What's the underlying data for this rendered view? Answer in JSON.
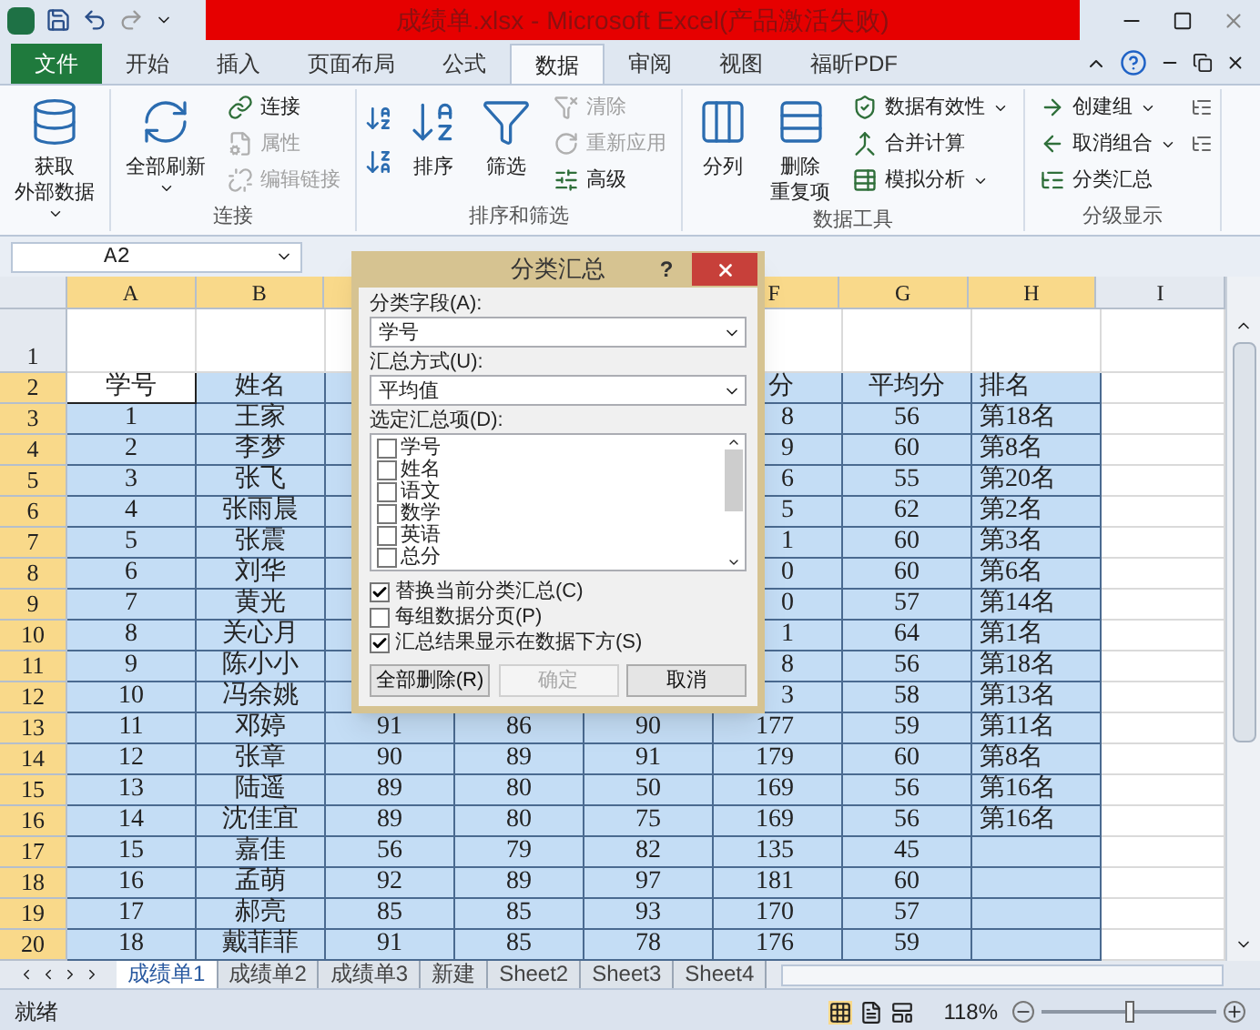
{
  "window": {
    "title": "成绩单.xlsx - Microsoft Excel(产品激活失败)"
  },
  "ribbon_tabs": [
    {
      "label": "文件",
      "kind": "file",
      "selected": false
    },
    {
      "label": "开始",
      "kind": "tab",
      "selected": false
    },
    {
      "label": "插入",
      "kind": "tab",
      "selected": false
    },
    {
      "label": "页面布局",
      "kind": "tab",
      "selected": false
    },
    {
      "label": "公式",
      "kind": "tab",
      "selected": false
    },
    {
      "label": "数据",
      "kind": "tab",
      "selected": true
    },
    {
      "label": "审阅",
      "kind": "tab",
      "selected": false
    },
    {
      "label": "视图",
      "kind": "tab",
      "selected": false
    },
    {
      "label": "福昕PDF",
      "kind": "tab",
      "selected": false
    }
  ],
  "ribbon_groups": [
    {
      "buttons": [
        {
          "lines": [
            "获取",
            "外部数据"
          ],
          "dropdown": true,
          "disabled": false
        }
      ]
    },
    {
      "label": "连接",
      "buttons": [
        {
          "lines": [
            "全部刷新"
          ],
          "dropdown": true,
          "disabled": false
        },
        {
          "lines": [
            "连接"
          ],
          "dropdown": false,
          "disabled": false
        },
        {
          "lines": [
            "属性"
          ],
          "dropdown": false,
          "disabled": true
        },
        {
          "lines": [
            "编辑链接"
          ],
          "dropdown": false,
          "disabled": true
        }
      ]
    },
    {
      "label": "排序和筛选",
      "buttons": [
        {
          "lines": [
            "排序"
          ],
          "dropdown": false,
          "disabled": false
        },
        {
          "lines": [
            "筛选"
          ],
          "dropdown": false,
          "disabled": false
        },
        {
          "lines": [
            "清除"
          ],
          "dropdown": false,
          "disabled": true
        },
        {
          "lines": [
            "重新应用"
          ],
          "dropdown": false,
          "disabled": true
        },
        {
          "lines": [
            "高级"
          ],
          "dropdown": false,
          "disabled": false
        }
      ]
    },
    {
      "label": "数据工具",
      "buttons": [
        {
          "lines": [
            "分列"
          ],
          "dropdown": false,
          "disabled": false
        },
        {
          "lines": [
            "删除",
            "重复项"
          ],
          "dropdown": false,
          "disabled": false
        },
        {
          "lines": [
            "数据有效性"
          ],
          "dropdown": true,
          "disabled": false
        },
        {
          "lines": [
            "合并计算"
          ],
          "dropdown": false,
          "disabled": false
        },
        {
          "lines": [
            "模拟分析"
          ],
          "dropdown": true,
          "disabled": false
        }
      ]
    },
    {
      "label": "分级显示",
      "buttons": [
        {
          "lines": [
            "创建组"
          ],
          "dropdown": true,
          "disabled": false
        },
        {
          "lines": [
            "取消组合"
          ],
          "dropdown": true,
          "disabled": false
        },
        {
          "lines": [
            "分类汇总"
          ],
          "dropdown": false,
          "disabled": false
        }
      ]
    }
  ],
  "name_box": "A2",
  "columns": [
    {
      "letter": "A",
      "highlighted": true
    },
    {
      "letter": "B",
      "highlighted": true
    },
    {
      "highlighted": true
    },
    {
      "letter": "F",
      "highlighted": true
    },
    {
      "letter": "G",
      "highlighted": true
    },
    {
      "letter": "H",
      "highlighted": true
    },
    {
      "letter": "I",
      "highlighted": false
    }
  ],
  "rows": [
    {
      "number": "1",
      "highlighted": false,
      "selected": false,
      "active": false,
      "cells": [
        null,
        null,
        null,
        null,
        null,
        null,
        null,
        null,
        null
      ]
    },
    {
      "number": "2",
      "highlighted": true,
      "selected": true,
      "active": true,
      "cells": [
        "学号",
        "姓名",
        null,
        null,
        null,
        "分",
        "平均分",
        "排名",
        null
      ]
    },
    {
      "number": "3",
      "highlighted": true,
      "selected": true,
      "active": false,
      "cells": [
        "1",
        "王家",
        null,
        null,
        null,
        "8",
        "56",
        "第18名",
        null
      ]
    },
    {
      "number": "4",
      "highlighted": true,
      "selected": true,
      "active": false,
      "cells": [
        "2",
        "李梦",
        null,
        null,
        null,
        "9",
        "60",
        "第8名",
        null
      ]
    },
    {
      "number": "5",
      "highlighted": true,
      "selected": true,
      "active": false,
      "cells": [
        "3",
        "张飞",
        null,
        null,
        null,
        "6",
        "55",
        "第20名",
        null
      ]
    },
    {
      "number": "6",
      "highlighted": true,
      "selected": true,
      "active": false,
      "cells": [
        "4",
        "张雨晨",
        null,
        null,
        null,
        "5",
        "62",
        "第2名",
        null
      ]
    },
    {
      "number": "7",
      "highlighted": true,
      "selected": true,
      "active": false,
      "cells": [
        "5",
        "张震",
        null,
        null,
        null,
        "1",
        "60",
        "第3名",
        null
      ]
    },
    {
      "number": "8",
      "highlighted": true,
      "selected": true,
      "active": false,
      "cells": [
        "6",
        "刘华",
        null,
        null,
        null,
        "0",
        "60",
        "第6名",
        null
      ]
    },
    {
      "number": "9",
      "highlighted": true,
      "selected": true,
      "active": false,
      "cells": [
        "7",
        "黄光",
        null,
        null,
        null,
        "0",
        "57",
        "第14名",
        null
      ]
    },
    {
      "number": "10",
      "highlighted": true,
      "selected": true,
      "active": false,
      "cells": [
        "8",
        "关心月",
        null,
        null,
        null,
        "1",
        "64",
        "第1名",
        null
      ]
    },
    {
      "number": "11",
      "highlighted": true,
      "selected": true,
      "active": false,
      "cells": [
        "9",
        "陈小小",
        null,
        null,
        null,
        "8",
        "56",
        "第18名",
        null
      ]
    },
    {
      "number": "12",
      "highlighted": true,
      "selected": true,
      "active": false,
      "cells": [
        "10",
        "冯余姚",
        null,
        null,
        null,
        "3",
        "58",
        "第13名",
        null
      ]
    },
    {
      "number": "13",
      "highlighted": true,
      "selected": true,
      "active": false,
      "cells": [
        "11",
        "邓婷",
        "91",
        "86",
        "90",
        "177",
        "59",
        "第11名",
        null
      ]
    },
    {
      "number": "14",
      "highlighted": true,
      "selected": true,
      "active": false,
      "cells": [
        "12",
        "张章",
        "90",
        "89",
        "91",
        "179",
        "60",
        "第8名",
        null
      ]
    },
    {
      "number": "15",
      "highlighted": true,
      "selected": true,
      "active": false,
      "cells": [
        "13",
        "陆遥",
        "89",
        "80",
        "50",
        "169",
        "56",
        "第16名",
        null
      ]
    },
    {
      "number": "16",
      "highlighted": true,
      "selected": true,
      "active": false,
      "cells": [
        "14",
        "沈佳宜",
        "89",
        "80",
        "75",
        "169",
        "56",
        "第16名",
        null
      ]
    },
    {
      "number": "17",
      "highlighted": true,
      "selected": true,
      "active": false,
      "cells": [
        "15",
        "嘉佳",
        "56",
        "79",
        "82",
        "135",
        "45",
        null,
        null
      ]
    },
    {
      "number": "18",
      "highlighted": true,
      "selected": true,
      "active": false,
      "cells": [
        "16",
        "孟萌",
        "92",
        "89",
        "97",
        "181",
        "60",
        null,
        null
      ]
    },
    {
      "number": "19",
      "highlighted": true,
      "selected": true,
      "active": false,
      "cells": [
        "17",
        "郝亮",
        "85",
        "85",
        "93",
        "170",
        "57",
        null,
        null
      ]
    },
    {
      "number": "20",
      "highlighted": true,
      "selected": true,
      "active": false,
      "cells": [
        "18",
        "戴菲菲",
        "91",
        "85",
        "78",
        "176",
        "59",
        null,
        null
      ]
    }
  ],
  "dialog": {
    "title": "分类汇总",
    "help": "?",
    "field_label": "分类字段(A):",
    "field_value": "学号",
    "method_label": "汇总方式(U):",
    "method_value": "平均值",
    "items_label": "选定汇总项(D):",
    "items": [
      {
        "label": "学号",
        "checked": false
      },
      {
        "label": "姓名",
        "checked": false
      },
      {
        "label": "语文",
        "checked": false
      },
      {
        "label": "数学",
        "checked": false
      },
      {
        "label": "英语",
        "checked": false
      },
      {
        "label": "总分",
        "checked": false
      }
    ],
    "options": [
      {
        "label": "替换当前分类汇总(C)",
        "checked": true
      },
      {
        "label": "每组数据分页(P)",
        "checked": false
      },
      {
        "label": "汇总结果显示在数据下方(S)",
        "checked": true
      }
    ],
    "buttons": [
      {
        "label": "全部删除(R)",
        "disabled": false
      },
      {
        "label": "确定",
        "disabled": true
      },
      {
        "label": "取消",
        "disabled": false
      }
    ]
  },
  "sheet_tabs": [
    {
      "label": "成绩单1",
      "selected": true
    },
    {
      "label": "成绩单2",
      "selected": false
    },
    {
      "label": "成绩单3",
      "selected": false
    },
    {
      "label": "新建",
      "selected": false
    },
    {
      "label": "Sheet2",
      "selected": false
    },
    {
      "label": "Sheet3",
      "selected": false
    },
    {
      "label": "Sheet4",
      "selected": false
    }
  ],
  "status_bar": {
    "status": "就绪",
    "zoom": "118%",
    "zoom_slider": {
      "level": 0.5
    }
  }
}
